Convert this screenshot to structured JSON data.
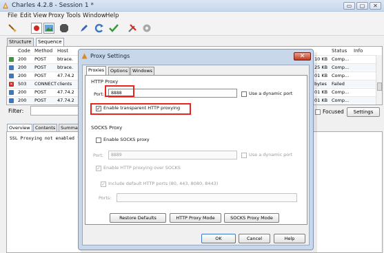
{
  "window": {
    "title": "Charles 4.2.8 - Session 1 *",
    "min": "▭",
    "max": "▢",
    "close": "✕"
  },
  "menu": [
    "File",
    "Edit",
    "View",
    "Proxy",
    "Tools",
    "Window",
    "Help"
  ],
  "toolbar_icons": [
    "broom-icon",
    "record-icon",
    "throttle-icon",
    "breakpoint-icon",
    "pen-icon",
    "refresh-icon",
    "check-icon",
    "tools-icon",
    "settings-gear-icon"
  ],
  "view_tabs": [
    "Structure",
    "Sequence"
  ],
  "table": {
    "columns": [
      "Code",
      "Method",
      "Host",
      "Status",
      "Info"
    ],
    "rows": [
      {
        "code": "200",
        "method": "POST",
        "host": "btrace.",
        "right": "10 KB",
        "status": "Comp..."
      },
      {
        "code": "200",
        "method": "POST",
        "host": "btrace.",
        "right": "25 KB",
        "status": "Comp..."
      },
      {
        "code": "200",
        "method": "POST",
        "host": "47.74.2",
        "right": "01 KB",
        "status": "Comp..."
      },
      {
        "code": "503",
        "method": "CONNECT",
        "host": "clients",
        "right": "bytes",
        "status": "Failed"
      },
      {
        "code": "200",
        "method": "POST",
        "host": "47.74.2",
        "right": "01 KB",
        "status": "Comp..."
      },
      {
        "code": "200",
        "method": "POST",
        "host": "47.74.2",
        "right": "01 KB",
        "status": "Comp..."
      }
    ]
  },
  "filter": {
    "label": "Filter:",
    "focused": "Focused",
    "settings": "Settings"
  },
  "bottom_tabs": [
    "Overview",
    "Contents",
    "Summar"
  ],
  "bottom_text": "SSL Proxying not enabled f",
  "dialog": {
    "title": "Proxy Settings",
    "close": "✕",
    "tabs": [
      "Proxies",
      "Options",
      "Windows"
    ],
    "http_section": "HTTP Proxy",
    "port_label": "Port:",
    "port_value": "8888",
    "dynamic_port": "Use a dynamic port",
    "transparent": "Enable transparent HTTP proxying",
    "socks_section": "SOCKS Proxy",
    "enable_socks": "Enable SOCKS proxy",
    "socks_port_label": "Port:",
    "socks_port_value": "8889",
    "socks_dynamic": "Use a dynamic port",
    "http_over_socks": "Enable HTTP proxying over SOCKS",
    "include_default": "Include default HTTP ports (80, 443, 8080, 8443)",
    "ports_label": "Ports:",
    "restore": "Restore Defaults",
    "http_mode": "HTTP Proxy Mode",
    "socks_mode": "SOCKS Proxy Mode",
    "ok": "OK",
    "cancel": "Cancel",
    "help": "Help"
  },
  "colors": {
    "highlight": "#e8231b",
    "success": "#3a9a3a",
    "error": "#d4261d",
    "info": "#3b78c4"
  }
}
